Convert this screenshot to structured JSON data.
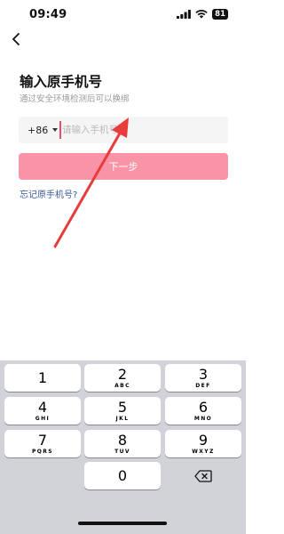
{
  "status_bar": {
    "time": "09:49",
    "battery": "81"
  },
  "page": {
    "title": "输入原手机号",
    "subtitle": "通过安全环境检测后可以换绑"
  },
  "phone_field": {
    "country_code": "+86",
    "placeholder": "请输入手机号",
    "value": ""
  },
  "next_button": {
    "label": "下一步"
  },
  "forgot_link": {
    "label": "忘记原手机号?"
  },
  "keypad": [
    {
      "digit": "1",
      "letters": ""
    },
    {
      "digit": "2",
      "letters": "ABC"
    },
    {
      "digit": "3",
      "letters": "DEF"
    },
    {
      "digit": "4",
      "letters": "GHI"
    },
    {
      "digit": "5",
      "letters": "JKL"
    },
    {
      "digit": "6",
      "letters": "MNO"
    },
    {
      "digit": "7",
      "letters": "PQRS"
    },
    {
      "digit": "8",
      "letters": "TUV"
    },
    {
      "digit": "9",
      "letters": "WXYZ"
    },
    {
      "digit": "0",
      "letters": ""
    }
  ],
  "colors": {
    "accent": "#f994a6",
    "cursor": "#ee4a6a",
    "annotation_arrow": "#e83c3c",
    "link": "#3a5a95"
  },
  "icons": [
    "signal-icon",
    "wifi-icon",
    "battery-icon",
    "back-chevron-icon",
    "dropdown-caret-icon",
    "backspace-icon",
    "annotation-arrow"
  ]
}
